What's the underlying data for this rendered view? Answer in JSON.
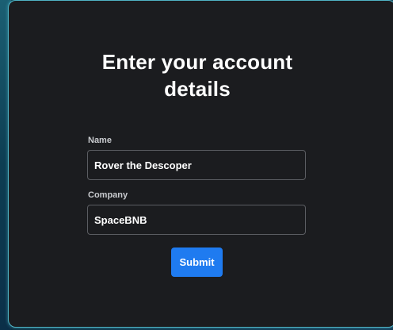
{
  "form": {
    "title_line1": "Enter your account",
    "title_line2": "details",
    "name_label": "Name",
    "name_value": "Rover the Descoper",
    "company_label": "Company",
    "company_value": "SpaceBNB",
    "submit_label": "Submit"
  },
  "colors": {
    "card_background": "#1b1c1f",
    "card_border": "#4fb3c4",
    "accent": "#1f7bf0"
  }
}
